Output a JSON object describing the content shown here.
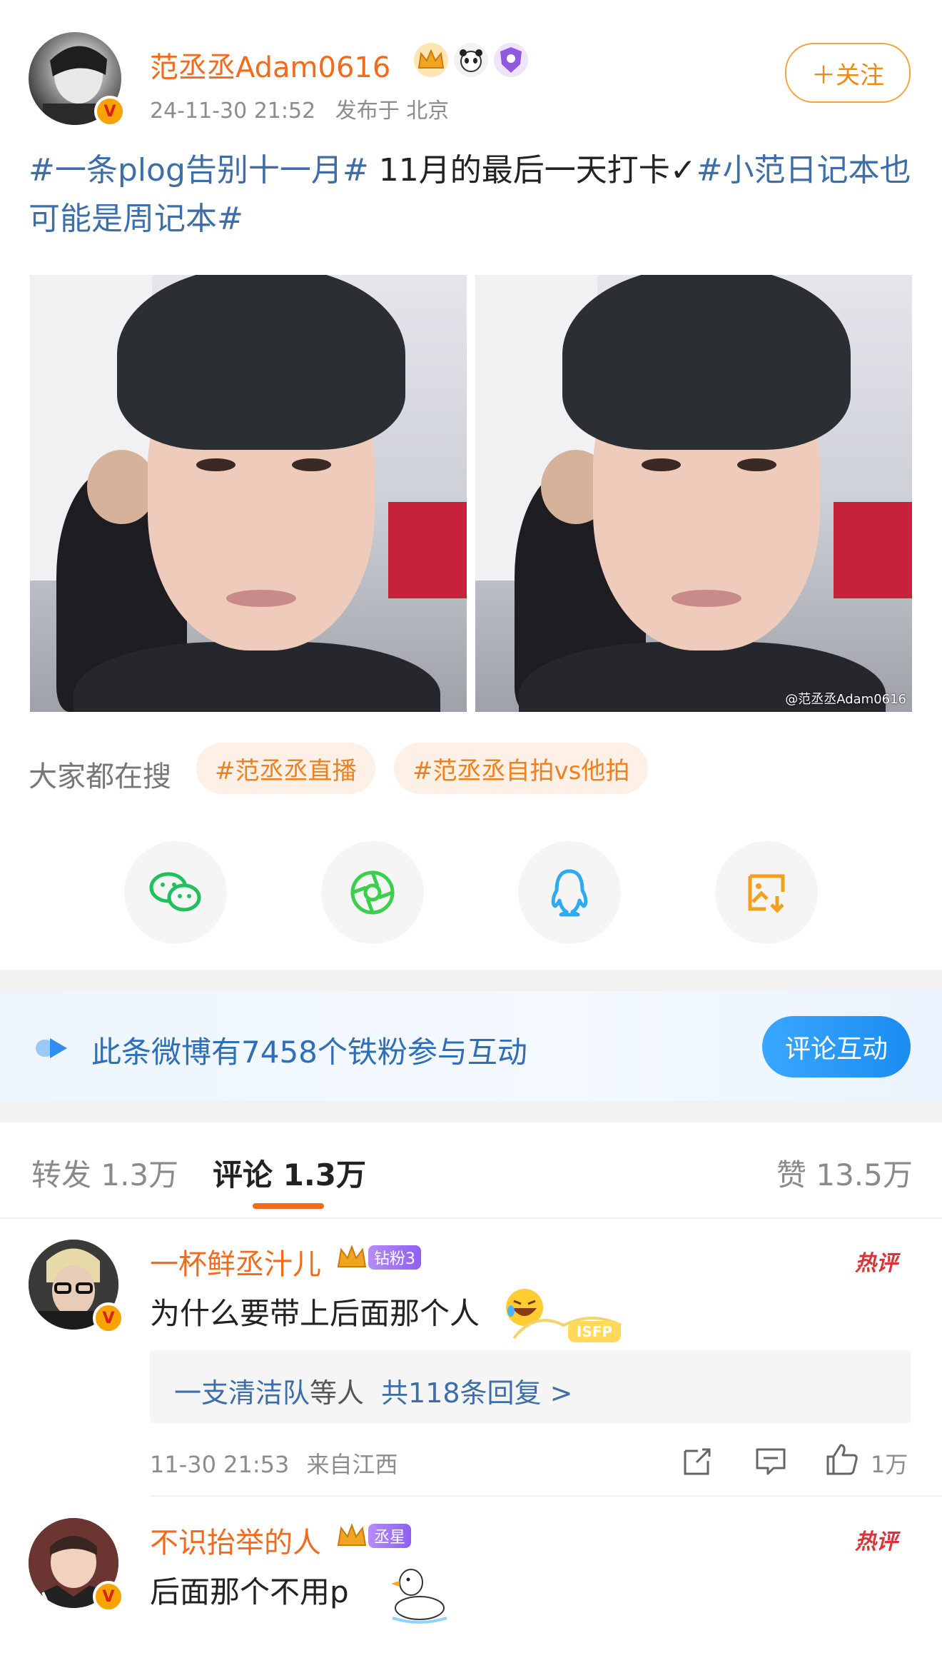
{
  "post": {
    "username": "范丞丞Adam0616",
    "timestamp": "24-11-30 21:52",
    "location": "发布于 北京",
    "follow_label": "＋关注",
    "text": {
      "tag1": "#一条plog告别十一月#",
      "body": " 11月的最后一天打卡✓",
      "tag2": "#小范日记本也可能是周记本#"
    },
    "watermark": "@范丞丞Adam0616"
  },
  "search": {
    "label": "大家都在搜",
    "chips": [
      "#范丞丞直播",
      "#范丞丞自拍vs他拍"
    ]
  },
  "share": {
    "items": [
      {
        "icon": "wechat-icon"
      },
      {
        "icon": "moments-icon"
      },
      {
        "icon": "qq-icon"
      },
      {
        "icon": "save-image-icon"
      }
    ]
  },
  "banner": {
    "text": "此条微博有7458个铁粉参与互动",
    "button": "评论互动"
  },
  "tabs": {
    "repost": "转发 1.3万",
    "comment": "评论 1.3万",
    "like": "赞 13.5万"
  },
  "comments": [
    {
      "name": "一杯鲜丞汁儿",
      "badge": "钻粉3",
      "hot": "热评",
      "text": "为什么要带上后面那个人",
      "replies_user": "一支清洁队",
      "replies_mid": "等人",
      "replies_count": "共118条回复 >",
      "time": "11-30 21:53",
      "from": "来自江西",
      "likes": "1万"
    },
    {
      "name": "不识抬举的人",
      "badge": "丞星",
      "hot": "热评",
      "text": "后面那个不用p"
    }
  ],
  "colors": {
    "accent_orange": "#f26a1b",
    "tag_blue": "#3e6ea8",
    "banner_blue": "#2e6fb8",
    "hot_red": "#d9343a"
  }
}
